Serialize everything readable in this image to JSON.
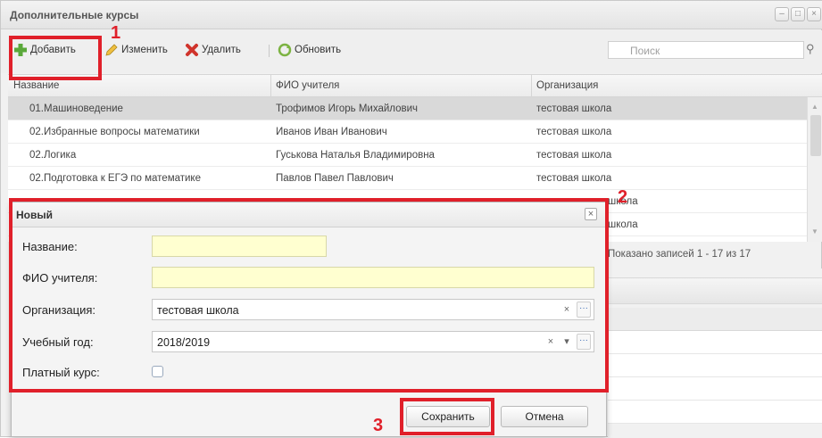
{
  "window": {
    "title": "Дополнительные курсы"
  },
  "toolbar": {
    "add_label": "Добавить",
    "edit_label": "Изменить",
    "delete_label": "Удалить",
    "refresh_label": "Обновить",
    "search_placeholder": "Поиск"
  },
  "grid": {
    "columns": [
      "Название",
      "ФИО учителя",
      "Организация"
    ],
    "rows": [
      [
        "01.Машиноведение",
        "Трофимов Игорь Михайлович",
        "тестовая школа"
      ],
      [
        "02.Избранные вопросы математики",
        "Иванов Иван Иванович",
        "тестовая школа"
      ],
      [
        "02.Логика",
        "Гуськова Наталья Владимировна",
        "тестовая школа"
      ],
      [
        "02.Подготовка к ЕГЭ по математике",
        "Павлов Павел Павлович",
        "тестовая школа"
      ],
      [
        "",
        "",
        "школа"
      ],
      [
        "",
        "",
        "школа"
      ]
    ],
    "paging_text": "Показано записей 1 - 17 из 17"
  },
  "dialog": {
    "title": "Новый",
    "fields": {
      "name_label": "Название:",
      "name_value": "",
      "teacher_label": "ФИО учителя:",
      "teacher_value": "",
      "org_label": "Организация:",
      "org_value": "тестовая школа",
      "year_label": "Учебный год:",
      "year_value": "2018/2019",
      "paid_label": "Платный курс:",
      "paid_checked": false
    },
    "save_label": "Сохранить",
    "cancel_label": "Отмена"
  },
  "annotations": {
    "step1": "1",
    "step2": "2",
    "step3": "3"
  },
  "colors": {
    "highlight": "#e0202a",
    "required_field": "#ffffd0",
    "selected_row": "#d9d9d9"
  },
  "icons": {
    "add": "plus-icon",
    "edit": "pencil-icon",
    "delete": "red-x-icon",
    "refresh": "refresh-icon",
    "search": "search-icon"
  }
}
